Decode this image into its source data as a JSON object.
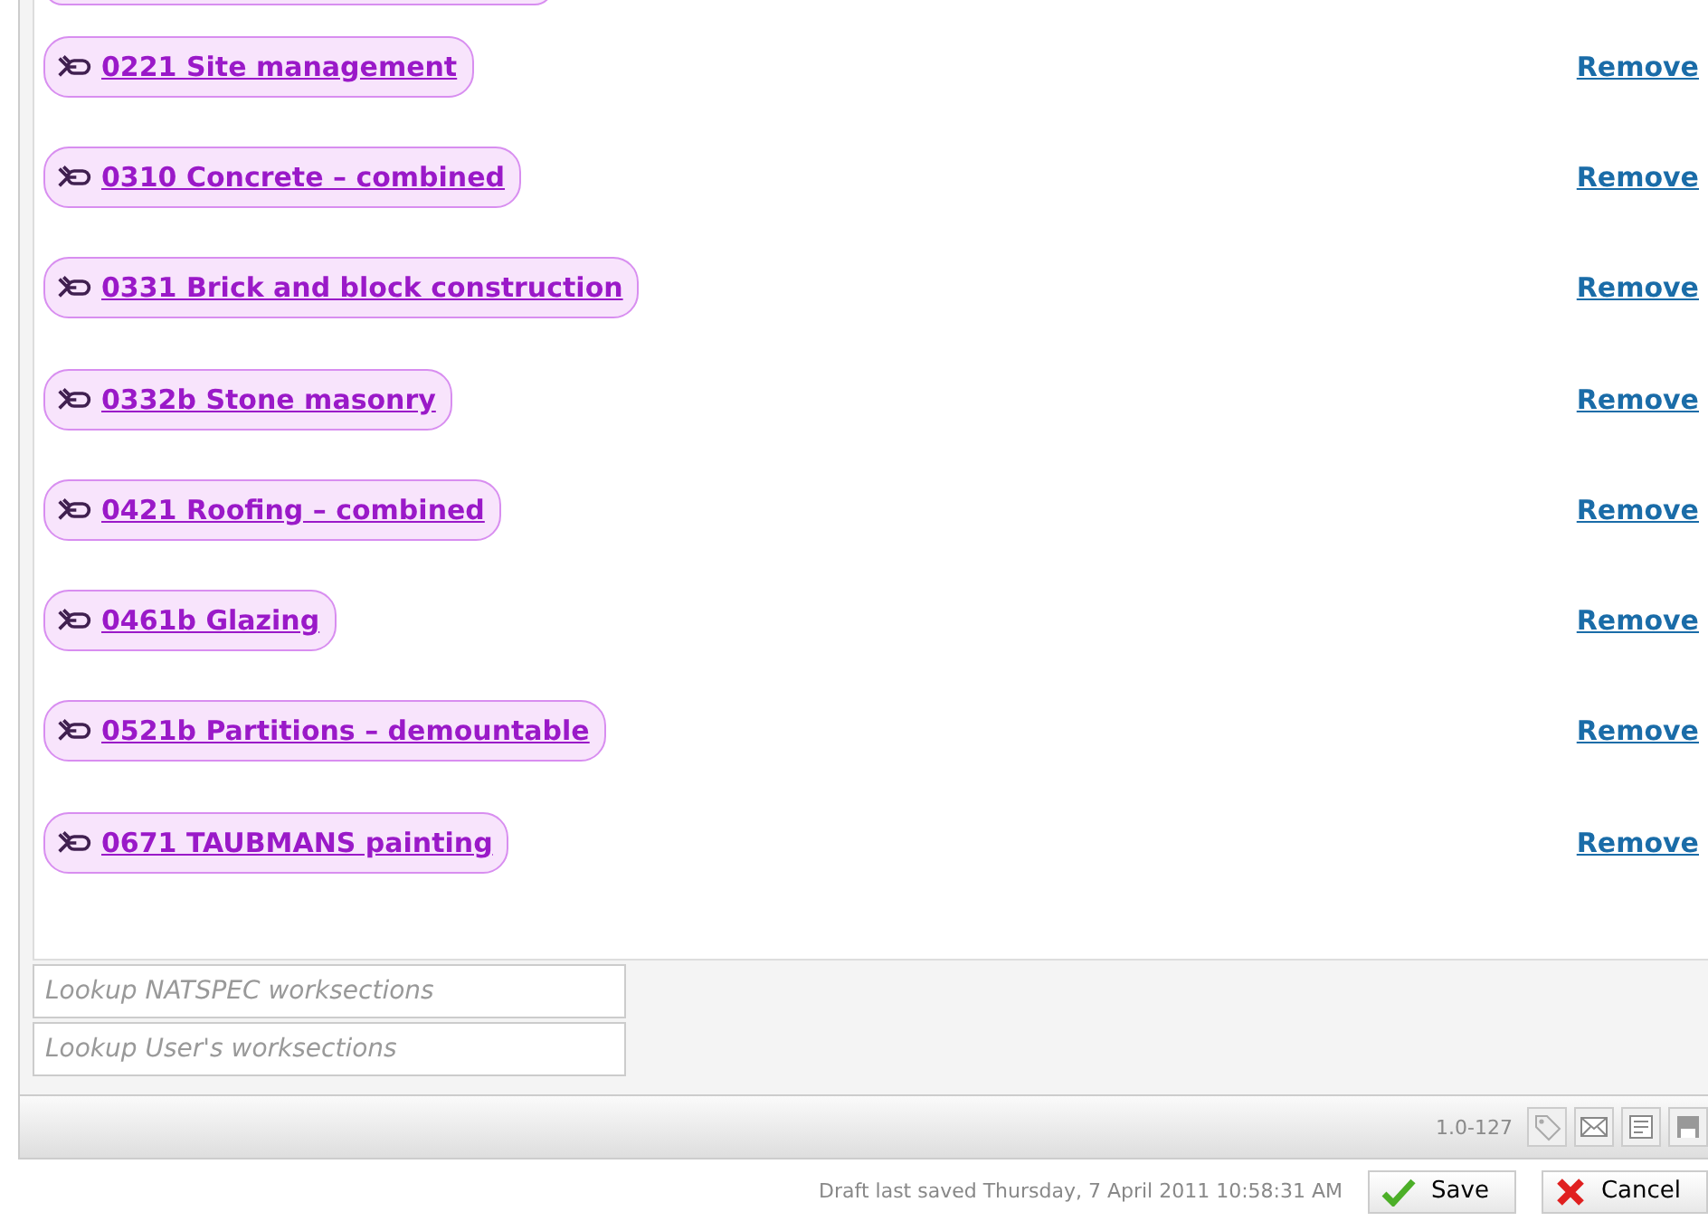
{
  "worksections": [
    {
      "label": "0221 Site management",
      "action": "Remove"
    },
    {
      "label": "0310 Concrete – combined",
      "action": "Remove"
    },
    {
      "label": "0331 Brick and block construction",
      "action": "Remove"
    },
    {
      "label": "0332b Stone masonry",
      "action": "Remove"
    },
    {
      "label": "0421 Roofing – combined",
      "action": "Remove"
    },
    {
      "label": "0461b Glazing",
      "action": "Remove"
    },
    {
      "label": "0521b Partitions – demountable",
      "action": "Remove"
    },
    {
      "label": "0671 TAUBMANS painting",
      "action": "Remove"
    }
  ],
  "lookups": [
    {
      "placeholder": "Lookup NATSPEC worksections"
    },
    {
      "placeholder": "Lookup User's worksections"
    }
  ],
  "status_bar": {
    "version": "1.0-127"
  },
  "footer": {
    "draft_status": "Draft last saved Thursday, 7 April 2011 10:58:31 AM",
    "buttons": [
      {
        "kind": "save",
        "label": "Save"
      },
      {
        "kind": "cancel",
        "label": "Cancel"
      }
    ]
  }
}
